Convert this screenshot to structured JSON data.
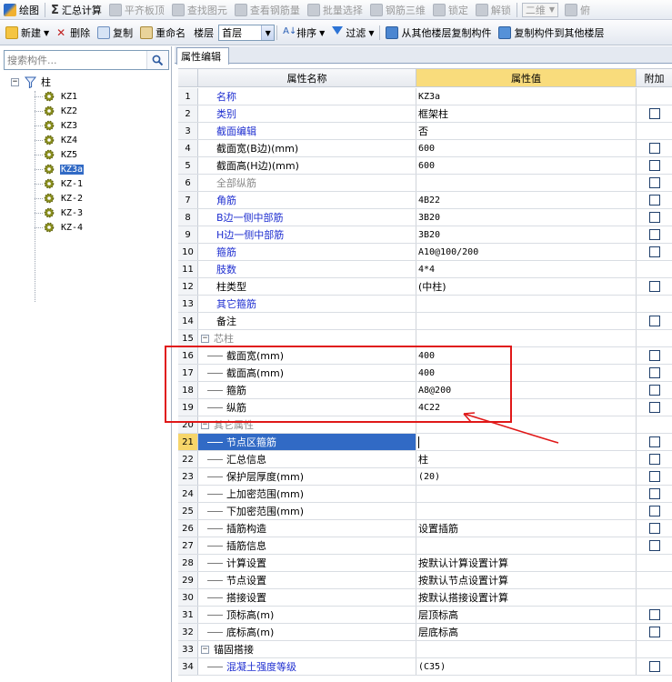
{
  "toolbar1": {
    "draw": "绘图",
    "sum_symbol": "Σ",
    "calc_summary": "汇总计算",
    "level_slab": "平齐板顶",
    "find_element": "查找图元",
    "view_rebar": "查看钢筋量",
    "batch_select": "批量选择",
    "rebar_3d": "钢筋三维",
    "lock": "锁定",
    "unlock": "解锁",
    "view_mode": "二维",
    "view_partial": "俯"
  },
  "toolbar2": {
    "new": "新建",
    "delete": "删除",
    "copy": "复制",
    "rename": "重命名",
    "floor_label": "楼层",
    "floor_value": "首层",
    "sort": "排序",
    "filter": "过滤",
    "copy_from_floor": "从其他楼层复制构件",
    "copy_to_floor": "复制构件到其他楼层"
  },
  "search": {
    "placeholder": "搜索构件..."
  },
  "tree": {
    "root": "柱",
    "selected_index": 5,
    "items": [
      "KZ1",
      "KZ2",
      "KZ3",
      "KZ4",
      "KZ5",
      "KZ3a",
      "KZ-1",
      "KZ-2",
      "KZ-3",
      "KZ-4"
    ]
  },
  "tab": {
    "label": "属性编辑"
  },
  "grid": {
    "headers": {
      "name": "属性名称",
      "value": "属性值",
      "extra": "附加"
    },
    "rows": [
      {
        "n": "1",
        "name": "名称",
        "value": "KZ3a",
        "style": "blue",
        "level": 0,
        "chk": false
      },
      {
        "n": "2",
        "name": "类别",
        "value": "框架柱",
        "style": "blue",
        "level": 0,
        "chk": true
      },
      {
        "n": "3",
        "name": "截面编辑",
        "value": "否",
        "style": "blue",
        "level": 0,
        "chk": false
      },
      {
        "n": "4",
        "name": "截面宽(B边)(mm)",
        "value": "600",
        "style": "",
        "level": 0,
        "chk": true
      },
      {
        "n": "5",
        "name": "截面高(H边)(mm)",
        "value": "600",
        "style": "",
        "level": 0,
        "chk": true
      },
      {
        "n": "6",
        "name": "全部纵筋",
        "value": "",
        "style": "gray",
        "level": 0,
        "chk": true
      },
      {
        "n": "7",
        "name": "角筋",
        "value": "4B22",
        "style": "blue",
        "level": 0,
        "chk": true
      },
      {
        "n": "8",
        "name": "B边一侧中部筋",
        "value": "3B20",
        "style": "blue",
        "level": 0,
        "chk": true
      },
      {
        "n": "9",
        "name": "H边一侧中部筋",
        "value": "3B20",
        "style": "blue",
        "level": 0,
        "chk": true
      },
      {
        "n": "10",
        "name": "箍筋",
        "value": "A10@100/200",
        "style": "blue",
        "level": 0,
        "chk": true
      },
      {
        "n": "11",
        "name": "肢数",
        "value": "4*4",
        "style": "blue",
        "level": 0,
        "chk": false
      },
      {
        "n": "12",
        "name": "柱类型",
        "value": "(中柱)",
        "style": "",
        "level": 0,
        "chk": true
      },
      {
        "n": "13",
        "name": "其它箍筋",
        "value": "",
        "style": "blue",
        "level": 0,
        "chk": false
      },
      {
        "n": "14",
        "name": "备注",
        "value": "",
        "style": "",
        "level": 0,
        "chk": true
      },
      {
        "n": "15",
        "name": "芯柱",
        "value": "",
        "style": "gray",
        "level": -1,
        "chk": false
      },
      {
        "n": "16",
        "name": "截面宽(mm)",
        "value": "400",
        "style": "",
        "level": 1,
        "chk": true
      },
      {
        "n": "17",
        "name": "截面高(mm)",
        "value": "400",
        "style": "",
        "level": 1,
        "chk": true
      },
      {
        "n": "18",
        "name": "箍筋",
        "value": "A8@200",
        "style": "",
        "level": 1,
        "chk": true
      },
      {
        "n": "19",
        "name": "纵筋",
        "value": "4C22",
        "style": "",
        "level": 1,
        "chk": true
      },
      {
        "n": "20",
        "name": "其它属性",
        "value": "",
        "style": "gray",
        "level": -1,
        "chk": false
      },
      {
        "n": "21",
        "name": "节点区箍筋",
        "value": "",
        "style": "",
        "level": 1,
        "chk": true
      },
      {
        "n": "22",
        "name": "汇总信息",
        "value": "柱",
        "style": "",
        "level": 1,
        "chk": true
      },
      {
        "n": "23",
        "name": "保护层厚度(mm)",
        "value": "(20)",
        "style": "",
        "level": 1,
        "chk": true
      },
      {
        "n": "24",
        "name": "上加密范围(mm)",
        "value": "",
        "style": "",
        "level": 1,
        "chk": true
      },
      {
        "n": "25",
        "name": "下加密范围(mm)",
        "value": "",
        "style": "",
        "level": 1,
        "chk": true
      },
      {
        "n": "26",
        "name": "插筋构造",
        "value": "设置插筋",
        "style": "",
        "level": 1,
        "chk": true
      },
      {
        "n": "27",
        "name": "插筋信息",
        "value": "",
        "style": "",
        "level": 1,
        "chk": true
      },
      {
        "n": "28",
        "name": "计算设置",
        "value": "按默认计算设置计算",
        "style": "",
        "level": 1,
        "chk": false
      },
      {
        "n": "29",
        "name": "节点设置",
        "value": "按默认节点设置计算",
        "style": "",
        "level": 1,
        "chk": false
      },
      {
        "n": "30",
        "name": "搭接设置",
        "value": "按默认搭接设置计算",
        "style": "",
        "level": 1,
        "chk": false
      },
      {
        "n": "31",
        "name": "顶标高(m)",
        "value": "层顶标高",
        "style": "",
        "level": 1,
        "chk": true
      },
      {
        "n": "32",
        "name": "底标高(m)",
        "value": "层底标高",
        "style": "",
        "level": 1,
        "chk": true
      },
      {
        "n": "33",
        "name": "锚固搭接",
        "value": "",
        "style": "",
        "level": -1,
        "chk": false
      },
      {
        "n": "34",
        "name": "混凝土强度等级",
        "value": "(C35)",
        "style": "blue",
        "level": 1,
        "chk": true
      }
    ],
    "active_row": 20
  },
  "colors": {
    "selection": "#316ac5",
    "header_value_bg": "#f9dc7c",
    "annotation_red": "#e01818",
    "blue_text": "#1f2fd0"
  }
}
